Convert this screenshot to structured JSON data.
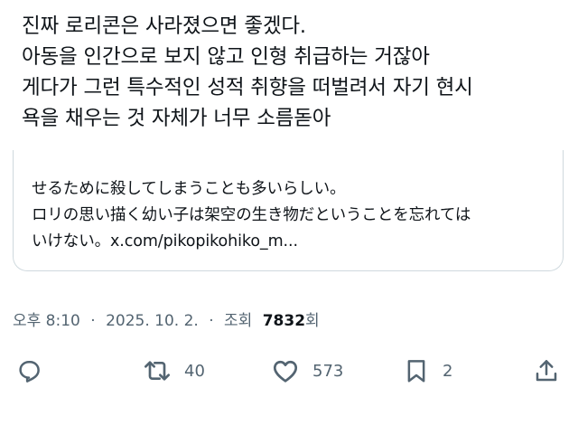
{
  "tweet": {
    "lines": [
      "진짜 로리콘은 사라졌으면 좋겠다.",
      "아동을 인간으로 보지 않고 인형 취급하는 거잖아",
      "게다가 그런 특수적인 성적 취향을 떠벌려서 자기 현시",
      "욕을 채우는 것 자체가 너무 소름돋아"
    ]
  },
  "quote": {
    "lines": [
      "せるために殺してしまうことも多いらしい。",
      "ロリの思い描く幼い子は架空の生き物だということを忘れては",
      "いけない。x.com/pikopikohiko_m..."
    ]
  },
  "meta": {
    "time": "오후 8:10",
    "separator": "·",
    "date": "2025. 10. 2.",
    "views_label": "조회",
    "views_count": "7832",
    "views_suffix": "회"
  },
  "actions": {
    "reply": {
      "icon": "reply-icon",
      "count": ""
    },
    "retweet": {
      "icon": "retweet-icon",
      "count": "40"
    },
    "like": {
      "icon": "heart-icon",
      "count": "573"
    },
    "bookmark": {
      "icon": "bookmark-icon",
      "count": "2"
    },
    "share": {
      "icon": "share-icon",
      "count": ""
    }
  },
  "colors": {
    "text": "#0f1419",
    "secondary": "#536471",
    "border": "#cfd9de",
    "background": "#ffffff"
  }
}
